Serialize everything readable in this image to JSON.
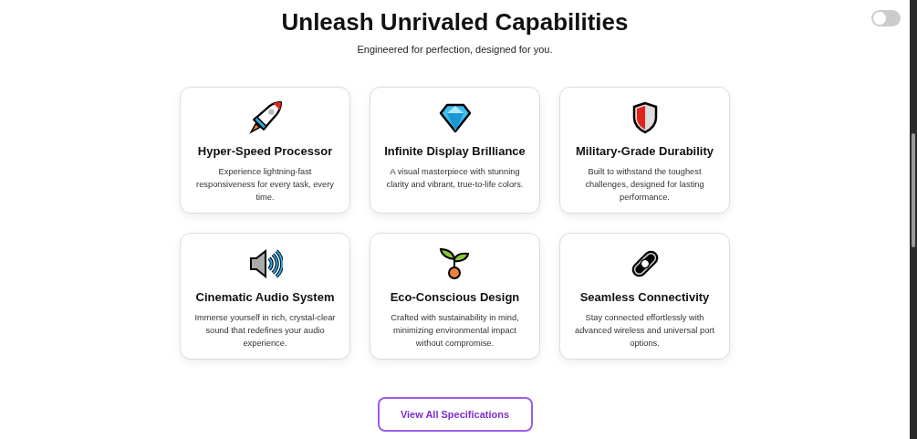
{
  "theme_toggle": {
    "on": false
  },
  "header": {
    "title": "Unleash Unrivaled Capabilities",
    "subtitle": "Engineered for perfection, designed for you."
  },
  "features": [
    {
      "title": "Hyper-Speed Processor",
      "description": "Experience lightning-fast responsiveness for every task, every time."
    },
    {
      "title": "Infinite Display Brilliance",
      "description": "A visual masterpiece with stunning clarity and vibrant, true-to-life colors."
    },
    {
      "title": "Military-Grade Durability",
      "description": "Built to withstand the toughest challenges, designed for lasting performance."
    },
    {
      "title": "Cinematic Audio System",
      "description": "Immerse yourself in rich, crystal-clear sound that redefines your audio experience."
    },
    {
      "title": "Eco-Conscious Design",
      "description": "Crafted with sustainability in mind, minimizing environmental impact without compromise."
    },
    {
      "title": "Seamless Connectivity",
      "description": "Stay connected effortlessly with advanced wireless and universal port options."
    }
  ],
  "cta": {
    "label": "View All Specifications"
  }
}
